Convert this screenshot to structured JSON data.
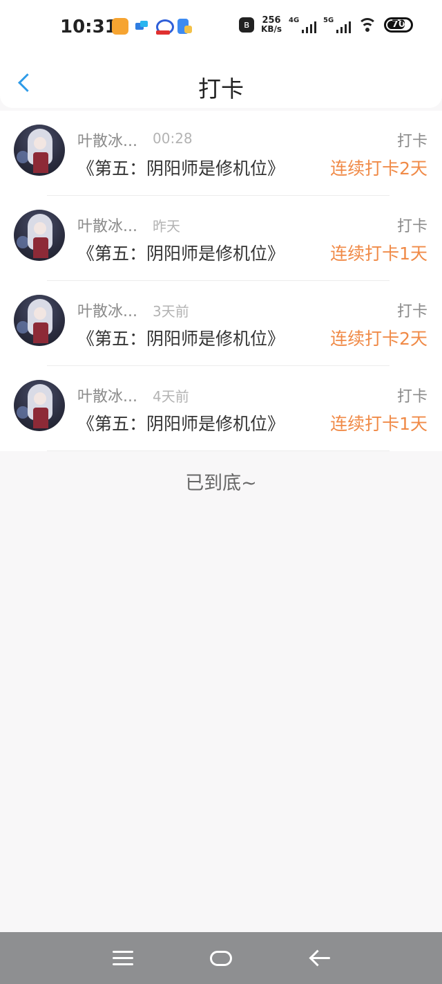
{
  "status_bar": {
    "time": "10:31",
    "net_speed_value": "256",
    "net_speed_unit": "KB/s",
    "signal_1_label": "4G",
    "signal_2_label": "5G",
    "battery": "70"
  },
  "header": {
    "title": "打卡"
  },
  "items": [
    {
      "name": "叶散冰...",
      "time": "00:28",
      "type": "打卡",
      "topic": "《第五：阴阳师是修机位》",
      "streak": "连续打卡2天"
    },
    {
      "name": "叶散冰...",
      "time": "昨天",
      "type": "打卡",
      "topic": "《第五：阴阳师是修机位》",
      "streak": "连续打卡1天"
    },
    {
      "name": "叶散冰...",
      "time": "3天前",
      "type": "打卡",
      "topic": "《第五：阴阳师是修机位》",
      "streak": "连续打卡2天"
    },
    {
      "name": "叶散冰...",
      "time": "4天前",
      "type": "打卡",
      "topic": "《第五：阴阳师是修机位》",
      "streak": "连续打卡1天"
    }
  ],
  "footer": {
    "end_text": "已到底~"
  },
  "colors": {
    "accent": "#2e9be8",
    "streak": "#f08a47",
    "background": "#f8f7f8",
    "nav_bar": "#8e8f91"
  }
}
